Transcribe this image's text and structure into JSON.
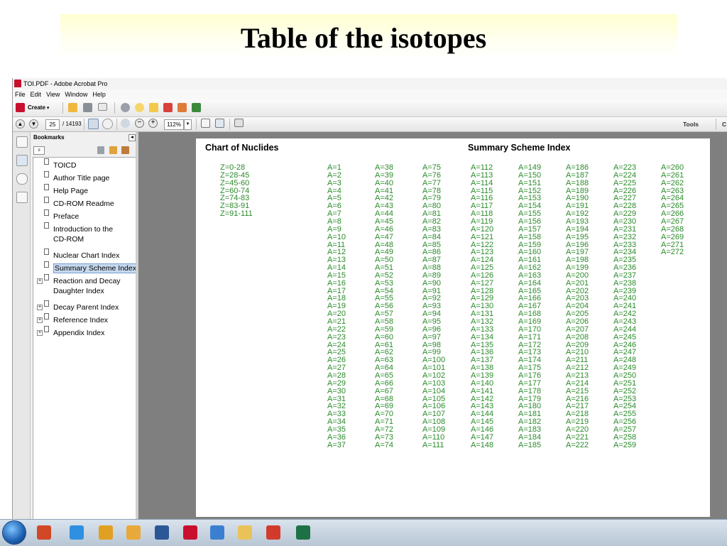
{
  "slide": {
    "title": "Table of the isotopes"
  },
  "window": {
    "title": "TOI.PDF - Adobe Acrobat Pro",
    "menu": [
      "File",
      "Edit",
      "View",
      "Window",
      "Help"
    ],
    "create_label": "Create",
    "page_number": "25",
    "page_total": "/ 14193",
    "zoom": "112%",
    "tools_label": "Tools",
    "right_cut_label": "C"
  },
  "bookmarks": {
    "header": "Bookmarks",
    "items": [
      {
        "label": "TOICD",
        "expandable": false,
        "selected": false
      },
      {
        "label": "Author Title page",
        "expandable": false,
        "selected": false
      },
      {
        "label": "Help Page",
        "expandable": false,
        "selected": false
      },
      {
        "label": "CD-ROM Readme",
        "expandable": false,
        "selected": false
      },
      {
        "label": "Preface",
        "expandable": false,
        "selected": false
      },
      {
        "label": "Introduction to the",
        "label2": "CD-ROM",
        "expandable": false,
        "selected": false
      },
      {
        "label": "Nuclear Chart Index",
        "expandable": false,
        "selected": false
      },
      {
        "label": "Summary Scheme Index",
        "expandable": false,
        "selected": true
      },
      {
        "label": "Reaction and Decay",
        "label2": "Daughter Index",
        "expandable": true,
        "selected": false
      },
      {
        "label": "Decay Parent Index",
        "expandable": true,
        "selected": false
      },
      {
        "label": "Reference Index",
        "expandable": true,
        "selected": false
      },
      {
        "label": "Appendix Index",
        "expandable": true,
        "selected": false
      }
    ]
  },
  "document": {
    "left_heading": "Chart of Nuclides",
    "center_heading": "Summary Scheme Index",
    "z_ranges": [
      "Z=0-28",
      "Z=28-45",
      "Z=45-60",
      "Z=60-74",
      "Z=74-83",
      "Z=83-91",
      "Z=91-111"
    ],
    "mass_columns": [
      [
        "A=1",
        "A=2",
        "A=3",
        "A=4",
        "A=5",
        "A=6",
        "A=7",
        "A=8",
        "A=9",
        "A=10",
        "A=11",
        "A=12",
        "A=13",
        "A=14",
        "A=15",
        "A=16",
        "A=17",
        "A=18",
        "A=19",
        "A=20",
        "A=21",
        "A=22",
        "A=23",
        "A=24",
        "A=25",
        "A=26",
        "A=27",
        "A=28",
        "A=29",
        "A=30",
        "A=31",
        "A=32",
        "A=33",
        "A=34",
        "A=35",
        "A=36",
        "A=37"
      ],
      [
        "A=38",
        "A=39",
        "A=40",
        "A=41",
        "A=42",
        "A=43",
        "A=44",
        "A=45",
        "A=46",
        "A=47",
        "A=48",
        "A=49",
        "A=50",
        "A=51",
        "A=52",
        "A=53",
        "A=54",
        "A=55",
        "A=56",
        "A=57",
        "A=58",
        "A=59",
        "A=60",
        "A=61",
        "A=62",
        "A=63",
        "A=64",
        "A=65",
        "A=66",
        "A=67",
        "A=68",
        "A=69",
        "A=70",
        "A=71",
        "A=72",
        "A=73",
        "A=74"
      ],
      [
        "A=75",
        "A=76",
        "A=77",
        "A=78",
        "A=79",
        "A=80",
        "A=81",
        "A=82",
        "A=83",
        "A=84",
        "A=85",
        "A=86",
        "A=87",
        "A=88",
        "A=89",
        "A=90",
        "A=91",
        "A=92",
        "A=93",
        "A=94",
        "A=95",
        "A=96",
        "A=97",
        "A=98",
        "A=99",
        "A=100",
        "A=101",
        "A=102",
        "A=103",
        "A=104",
        "A=105",
        "A=106",
        "A=107",
        "A=108",
        "A=109",
        "A=110",
        "A=111"
      ],
      [
        "A=112",
        "A=113",
        "A=114",
        "A=115",
        "A=116",
        "A=117",
        "A=118",
        "A=119",
        "A=120",
        "A=121",
        "A=122",
        "A=123",
        "A=124",
        "A=125",
        "A=126",
        "A=127",
        "A=128",
        "A=129",
        "A=130",
        "A=131",
        "A=132",
        "A=133",
        "A=134",
        "A=135",
        "A=136",
        "A=137",
        "A=138",
        "A=139",
        "A=140",
        "A=141",
        "A=142",
        "A=143",
        "A=144",
        "A=145",
        "A=146",
        "A=147",
        "A=148"
      ],
      [
        "A=149",
        "A=150",
        "A=151",
        "A=152",
        "A=153",
        "A=154",
        "A=155",
        "A=156",
        "A=157",
        "A=158",
        "A=159",
        "A=160",
        "A=161",
        "A=162",
        "A=163",
        "A=164",
        "A=165",
        "A=166",
        "A=167",
        "A=168",
        "A=169",
        "A=170",
        "A=171",
        "A=172",
        "A=173",
        "A=174",
        "A=175",
        "A=176",
        "A=177",
        "A=178",
        "A=179",
        "A=180",
        "A=181",
        "A=182",
        "A=183",
        "A=184",
        "A=185"
      ],
      [
        "A=186",
        "A=187",
        "A=188",
        "A=189",
        "A=190",
        "A=191",
        "A=192",
        "A=193",
        "A=194",
        "A=195",
        "A=196",
        "A=197",
        "A=198",
        "A=199",
        "A=200",
        "A=201",
        "A=202",
        "A=203",
        "A=204",
        "A=205",
        "A=206",
        "A=207",
        "A=208",
        "A=209",
        "A=210",
        "A=211",
        "A=212",
        "A=213",
        "A=214",
        "A=215",
        "A=216",
        "A=217",
        "A=218",
        "A=219",
        "A=220",
        "A=221",
        "A=222"
      ],
      [
        "A=223",
        "A=224",
        "A=225",
        "A=226",
        "A=227",
        "A=228",
        "A=229",
        "A=230",
        "A=231",
        "A=232",
        "A=233",
        "A=234",
        "A=235",
        "A=236",
        "A=237",
        "A=238",
        "A=239",
        "A=240",
        "A=241",
        "A=242",
        "A=243",
        "A=244",
        "A=245",
        "A=246",
        "A=247",
        "A=248",
        "A=249",
        "A=250",
        "A=251",
        "A=252",
        "A=253",
        "A=254",
        "A=255",
        "A=256",
        "A=257",
        "A=258",
        "A=259"
      ],
      [
        "A=260",
        "A=261",
        "A=262",
        "A=263",
        "A=264",
        "A=265",
        "A=266",
        "A=267",
        "A=268",
        "A=269",
        "A=271",
        "A=272"
      ]
    ],
    "link_color": "#2a8a2a"
  },
  "taskbar": {
    "apps": [
      {
        "icon": "powerpoint-icon",
        "color": "#d24726"
      },
      {
        "icon": "internet-explorer-icon",
        "color": "#2f8fe0"
      },
      {
        "icon": "chrome-icon",
        "color": "#e0a020"
      },
      {
        "icon": "outlook-icon",
        "color": "#e8a93a"
      },
      {
        "icon": "word-icon",
        "color": "#2b5797"
      },
      {
        "icon": "acrobat-icon",
        "color": "#c8102e"
      },
      {
        "icon": "outlook-express-icon",
        "color": "#3b7fd0"
      },
      {
        "icon": "folder-icon",
        "color": "#e9c35a"
      },
      {
        "icon": "antivirus-icon",
        "color": "#d23b2b"
      },
      {
        "icon": "excel-icon",
        "color": "#1e7145"
      }
    ]
  }
}
